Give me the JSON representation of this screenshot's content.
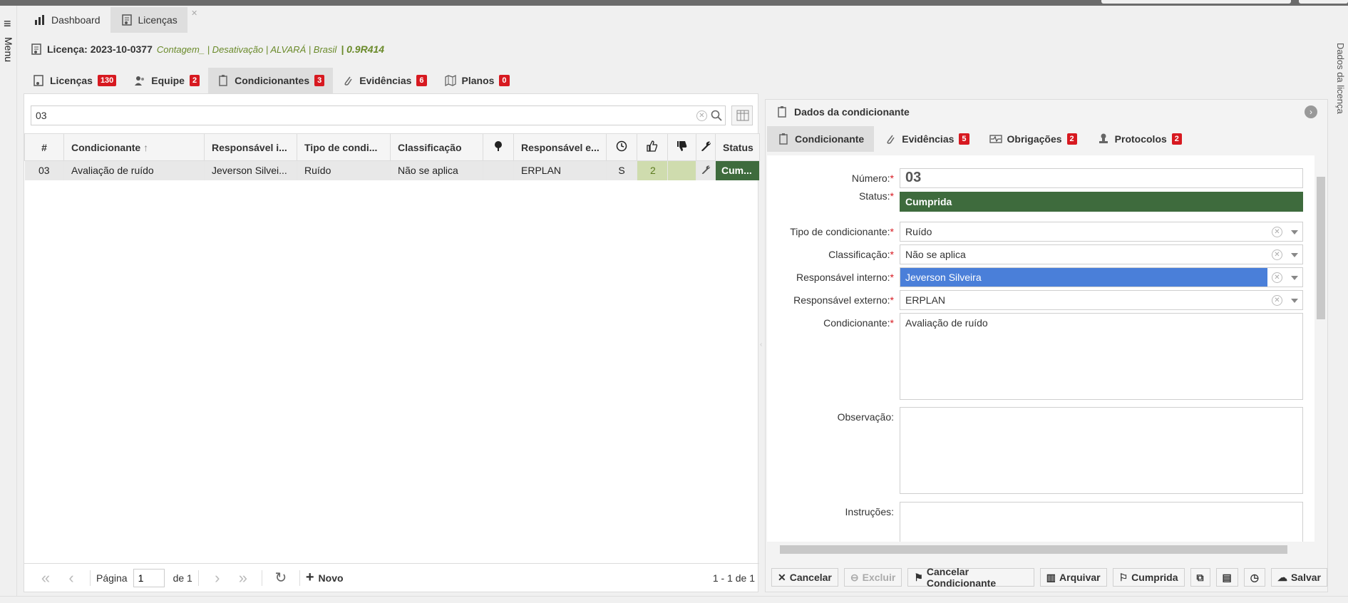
{
  "app_tabs": [
    {
      "label": "Dashboard",
      "icon": "bar-chart-icon"
    },
    {
      "label": "Licenças",
      "icon": "license-icon"
    }
  ],
  "license": {
    "title": "Licença: 2023-10-0377",
    "subtitle": "Contagem_ | Desativação | ALVARÁ | Brasil",
    "version": "| 0.9R414"
  },
  "sub_tabs": [
    {
      "label": "Licenças",
      "badge": "130"
    },
    {
      "label": "Equipe",
      "badge": "2"
    },
    {
      "label": "Condicionantes",
      "badge": "3"
    },
    {
      "label": "Evidências",
      "badge": "6"
    },
    {
      "label": "Planos",
      "badge": "0"
    }
  ],
  "search": {
    "value": "03"
  },
  "grid": {
    "columns": [
      "#",
      "Condicionante",
      "Responsável i...",
      "Tipo de condi...",
      "Classificação",
      "",
      "Responsável e...",
      "",
      "",
      "",
      "",
      "Status"
    ],
    "rows": [
      {
        "num": "03",
        "condicionante": "Avaliação de ruído",
        "resp_interno": "Jeverson Silvei...",
        "tipo": "Ruído",
        "classificacao": "Não se aplica",
        "resp_externo": "ERPLAN",
        "prazo": "S",
        "evidencias": "2",
        "status": "Cum..."
      }
    ]
  },
  "pager": {
    "page_label": "Página",
    "page_value": "1",
    "of_label": "de 1",
    "new_label": "Novo",
    "range": "1 - 1 de 1"
  },
  "detail": {
    "header": "Dados da condicionante",
    "tabs": [
      {
        "label": "Condicionante",
        "badge": ""
      },
      {
        "label": "Evidências",
        "badge": "5"
      },
      {
        "label": "Obrigações",
        "badge": "2"
      },
      {
        "label": "Protocolos",
        "badge": "2"
      }
    ],
    "fields": {
      "numero_label": "Número:",
      "numero": "03",
      "status_label": "Status:",
      "status": "Cumprida",
      "tipo_label": "Tipo de condicionante:",
      "tipo": "Ruído",
      "classificacao_label": "Classificação:",
      "classificacao": "Não se aplica",
      "resp_interno_label": "Responsável interno:",
      "resp_interno": "Jeverson Silveira",
      "resp_externo_label": "Responsável externo:",
      "resp_externo": "ERPLAN",
      "condicionante_label": "Condicionante:",
      "condicionante": "Avaliação de ruído",
      "observacao_label": "Observação:",
      "instrucoes_label": "Instruções:"
    },
    "footer_buttons": {
      "cancelar": "Cancelar",
      "excluir": "Excluir",
      "cancelar_cond": "Cancelar Condicionante",
      "arquivar": "Arquivar",
      "cumprida": "Cumprida",
      "salvar": "Salvar"
    }
  },
  "side_labels": {
    "menu": "Menu",
    "right": "Dados da licença"
  },
  "colors": {
    "status_green": "#3e6b3d",
    "badge_red": "#d71920",
    "highlight_blue": "#4a7fd9",
    "ok_green": "#cfdcae"
  }
}
